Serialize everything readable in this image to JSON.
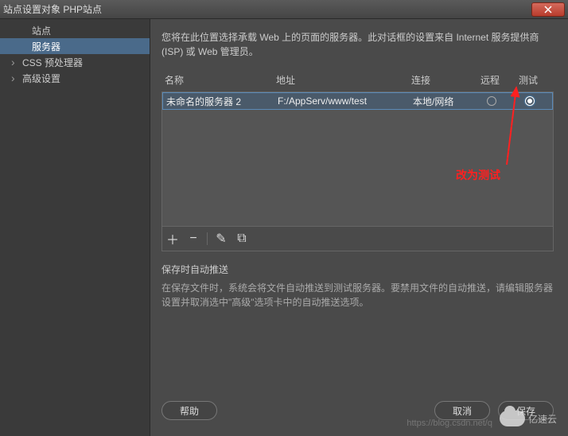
{
  "titlebar": {
    "text": "站点设置对象 PHP站点"
  },
  "sidebar": {
    "items": [
      {
        "label": "站点",
        "hasChevron": false
      },
      {
        "label": "服务器",
        "hasChevron": false,
        "active": true
      },
      {
        "label": "CSS 预处理器",
        "hasChevron": true
      },
      {
        "label": "高级设置",
        "hasChevron": true
      }
    ]
  },
  "intro": "您将在此位置选择承载 Web 上的页面的服务器。此对话框的设置来自 Internet 服务提供商 (ISP) 或 Web 管理员。",
  "table": {
    "headers": {
      "name": "名称",
      "addr": "地址",
      "conn": "连接",
      "remote": "远程",
      "test": "测试"
    },
    "rows": [
      {
        "name": "未命名的服务器 2",
        "addr": "F:/AppServ/www/test",
        "conn": "本地/网络",
        "remote": false,
        "test": true
      }
    ]
  },
  "toolbar": {
    "add": "＋",
    "remove": "−",
    "edit": "✎",
    "duplicate": "⧉"
  },
  "autopush": {
    "title": "保存时自动推送",
    "text": "在保存文件时，系统会将文件自动推送到测试服务器。要禁用文件的自动推送，请编辑服务器设置并取消选中\"高级\"选项卡中的自动推送选项。"
  },
  "buttons": {
    "help": "帮助",
    "cancel": "取消",
    "save": "保存"
  },
  "annotation": {
    "text": "改为测试"
  },
  "watermark": {
    "url": "https://blog.csdn.net/q",
    "logo": "亿速云"
  }
}
